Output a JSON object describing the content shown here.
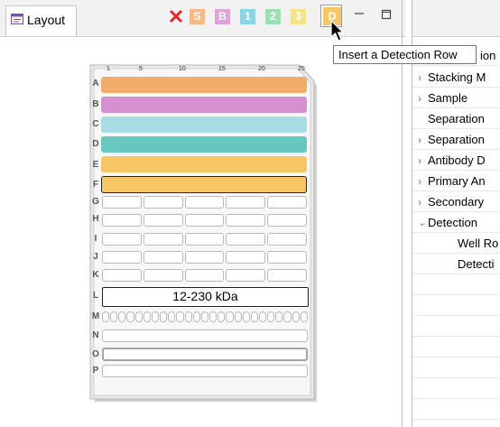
{
  "layout_tab": {
    "title": "Layout",
    "icon": "layout-view-icon"
  },
  "toolbar": {
    "delete_icon": "red-x-icon",
    "delete_color": "#e8262e",
    "buttons": [
      {
        "label": "S",
        "color": "#f6ba8a"
      },
      {
        "label": "B",
        "color": "#dda4d8"
      },
      {
        "label": "1",
        "color": "#8dd3e7"
      },
      {
        "label": "2",
        "color": "#9fe0b2"
      },
      {
        "label": "3",
        "color": "#f3e38a"
      },
      {
        "label": "D",
        "color": "#f7c766"
      }
    ],
    "tooltip": "Insert a Detection Row"
  },
  "gel": {
    "ticks": [
      "1",
      "5",
      "10",
      "15",
      "20",
      "25"
    ],
    "rows": [
      "A",
      "B",
      "C",
      "D",
      "E",
      "F",
      "G",
      "H",
      "I",
      "J",
      "K",
      "L",
      "M",
      "N",
      "O",
      "P"
    ],
    "row_colors": {
      "A": "#f2ac6a",
      "B": "#d68fd1",
      "C": "#a9dde6",
      "D": "#67c8c0",
      "E": "#f7c766",
      "F": "#f7c766"
    },
    "marker_label": "12-230 kDa"
  },
  "outline": {
    "items": [
      {
        "label": "ion",
        "chevron": ""
      },
      {
        "label": "Stacking M",
        "chevron": "right"
      },
      {
        "label": "Sample",
        "chevron": "right"
      },
      {
        "label": "Separation",
        "chevron": ""
      },
      {
        "label": "Separation",
        "chevron": "right"
      },
      {
        "label": "Antibody D",
        "chevron": "right"
      },
      {
        "label": "Primary An",
        "chevron": "right"
      },
      {
        "label": "Secondary",
        "chevron": "right"
      },
      {
        "label": "Detection",
        "chevron": "down"
      },
      {
        "label": "Well Ro",
        "chevron": ""
      },
      {
        "label": "Detecti",
        "chevron": ""
      }
    ]
  }
}
